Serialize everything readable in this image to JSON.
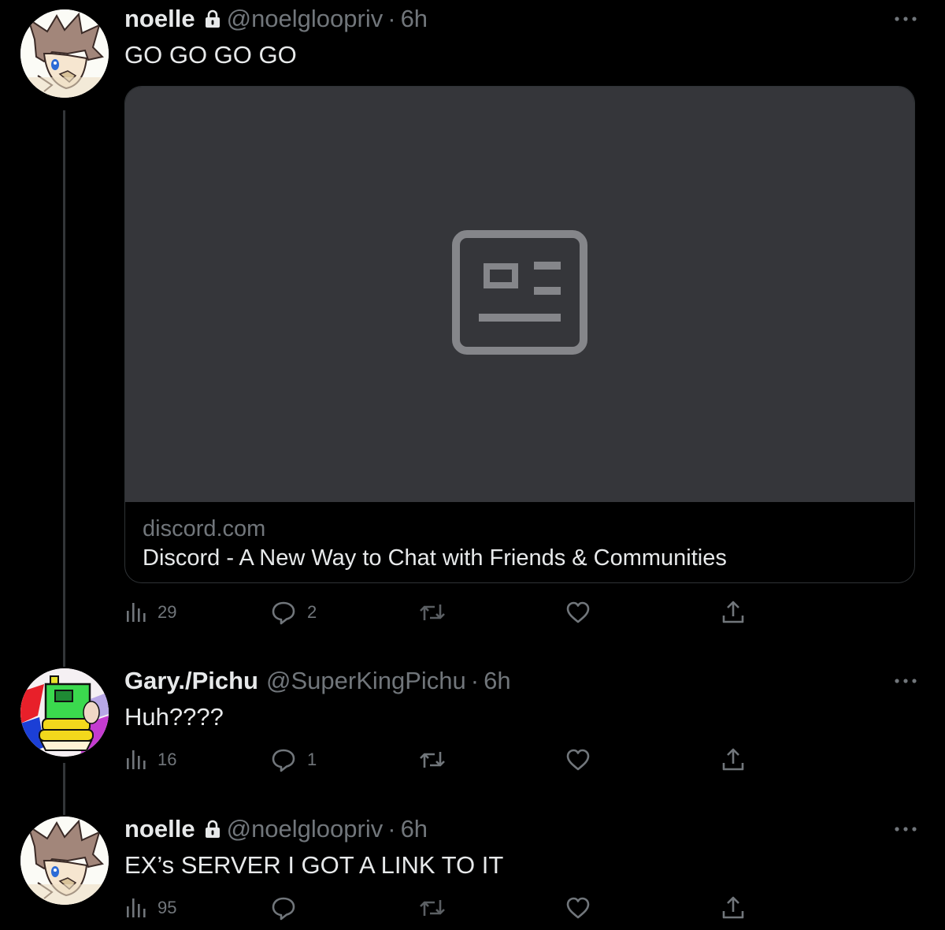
{
  "colors": {
    "background": "#000000",
    "text_primary": "#e7e9ea",
    "text_secondary": "#71767b",
    "card_media_bg": "#35363a",
    "border": "#2f3336"
  },
  "tweets": [
    {
      "name": "noelle",
      "locked": true,
      "handle": "@noelgloopriv",
      "separator": "·",
      "time": "6h",
      "text": "GO GO GO GO",
      "avatar": "brown-haired-character-avatar",
      "card": {
        "domain": "discord.com",
        "title": "Discord - A New Way to Chat with Friends & Communities",
        "media_icon": "article-placeholder-icon"
      },
      "stats": {
        "views": "29",
        "replies": "2",
        "retweets": "",
        "likes": ""
      }
    },
    {
      "name": "Gary./Pichu",
      "locked": false,
      "handle": "@SuperKingPichu",
      "separator": "·",
      "time": "6h",
      "text": "Huh????",
      "avatar": "green-face-colorful-avatar",
      "stats": {
        "views": "16",
        "replies": "1",
        "retweets": "",
        "likes": ""
      }
    },
    {
      "name": "noelle",
      "locked": true,
      "handle": "@noelgloopriv",
      "separator": "·",
      "time": "6h",
      "text": "EX’s SERVER I GOT A LINK TO IT",
      "avatar": "brown-haired-character-avatar",
      "stats": {
        "views": "95",
        "replies": "",
        "retweets": "",
        "likes": ""
      }
    }
  ],
  "icons": {
    "more": "more-icon",
    "views": "views-icon",
    "reply": "reply-icon",
    "retweet": "retweet-icon",
    "like": "like-icon",
    "share": "share-icon",
    "lock": "lock-icon"
  }
}
